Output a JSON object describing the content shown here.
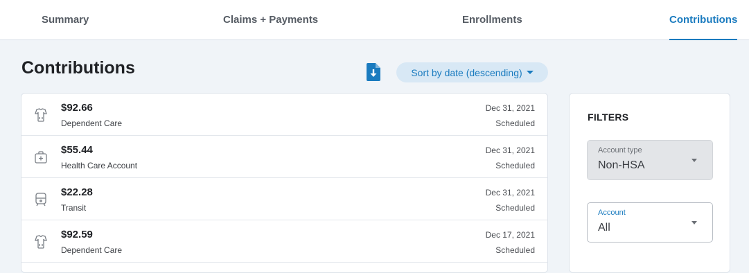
{
  "tabs": [
    {
      "label": "Summary"
    },
    {
      "label": "Claims + Payments"
    },
    {
      "label": "Enrollments"
    },
    {
      "label": "Contributions"
    }
  ],
  "active_tab": "Contributions",
  "page_title": "Contributions",
  "toolbar": {
    "download_icon": "download-document-icon",
    "sort_label": "Sort by date (descending)"
  },
  "contributions": [
    {
      "amount": "$92.66",
      "account": "Dependent Care",
      "date": "Dec 31, 2021",
      "status": "Scheduled",
      "icon": "dependent-care-icon"
    },
    {
      "amount": "$55.44",
      "account": "Health Care Account",
      "date": "Dec 31, 2021",
      "status": "Scheduled",
      "icon": "health-care-icon"
    },
    {
      "amount": "$22.28",
      "account": "Transit",
      "date": "Dec 31, 2021",
      "status": "Scheduled",
      "icon": "transit-icon"
    },
    {
      "amount": "$92.59",
      "account": "Dependent Care",
      "date": "Dec 17, 2021",
      "status": "Scheduled",
      "icon": "dependent-care-icon"
    }
  ],
  "filters": {
    "title": "FILTERS",
    "account_type": {
      "label": "Account type",
      "value": "Non-HSA"
    },
    "account": {
      "label": "Account",
      "value": "All"
    }
  },
  "colors": {
    "accent": "#1a7bbf",
    "sort_button_bg": "#d8e8f5",
    "page_bg": "#f0f4f8"
  }
}
